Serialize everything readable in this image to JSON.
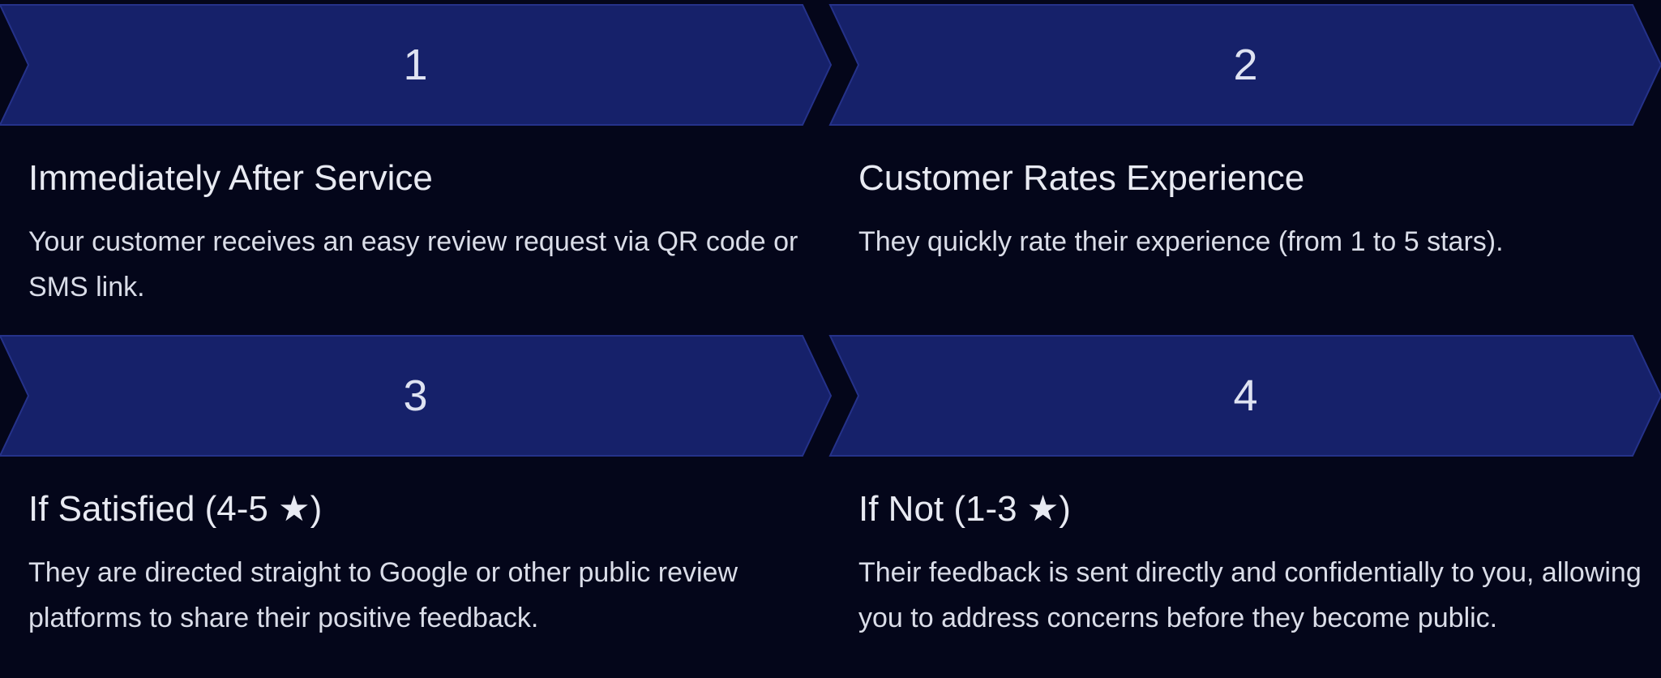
{
  "colors": {
    "background": "#04061a",
    "chevron_fill": "#16216a",
    "chevron_stroke": "#25328a",
    "text": "#e8eaf2"
  },
  "steps": [
    {
      "number": "1",
      "title": "Immediately After Service",
      "description": "Your customer receives an easy review request via QR code or SMS link."
    },
    {
      "number": "2",
      "title": "Customer Rates Experience",
      "description": "They quickly rate their experience (from 1 to 5 stars)."
    },
    {
      "number": "3",
      "title": "If Satisfied (4-5 ★)",
      "description": "They are directed straight to Google or other public review platforms to share their positive feedback."
    },
    {
      "number": "4",
      "title": "If Not (1-3 ★)",
      "description": "Their feedback is sent directly and confidentially to you, allowing you to address concerns before they become public."
    }
  ]
}
